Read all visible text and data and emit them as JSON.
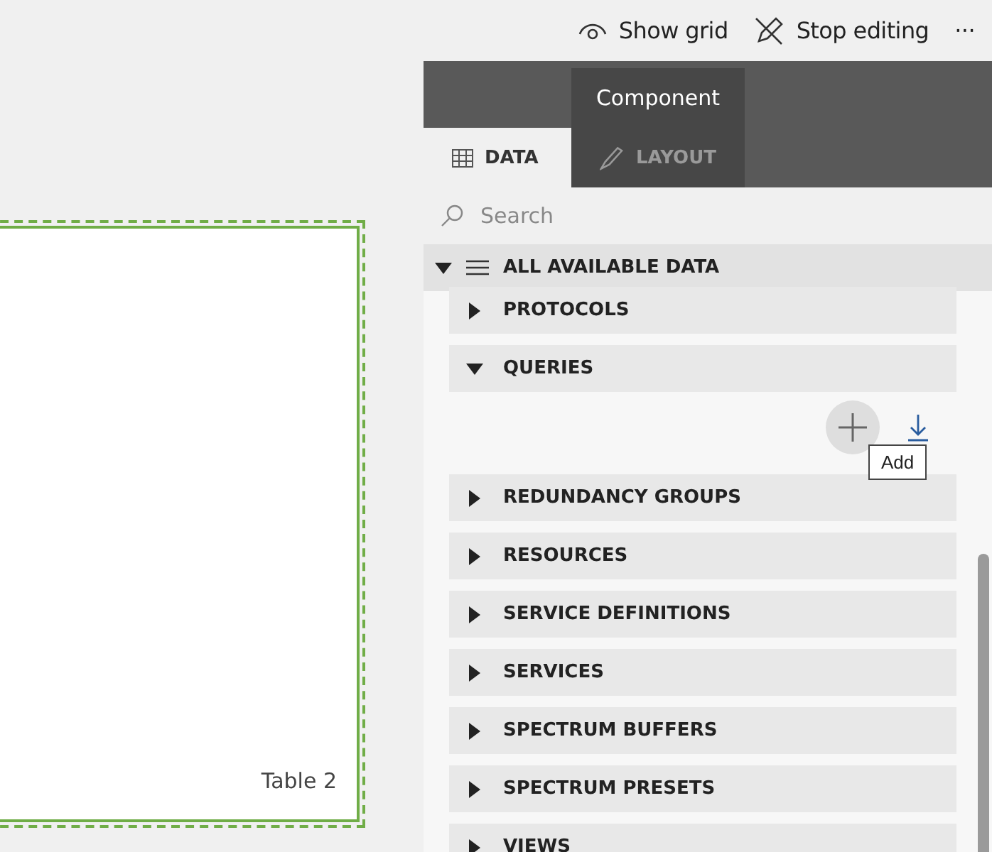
{
  "toolbar": {
    "actions": [
      {
        "kind": "eye",
        "label": "Show grid"
      },
      {
        "kind": "pencil",
        "label": "Stop editing"
      },
      {
        "kind": "more",
        "label": "···"
      }
    ]
  },
  "canvas": {
    "component": {
      "label": "Table 2",
      "selected": true
    }
  },
  "panel": {
    "tabs": [
      {
        "kind": "table",
        "label": "DATA",
        "selected": true
      },
      {
        "kind": "brush",
        "label": "LAYOUT",
        "selected": false
      }
    ],
    "tab_tooltip": "Component",
    "search": {
      "placeholder": "Search"
    },
    "tree": {
      "label": "ALL AVAILABLE DATA",
      "expanded": true,
      "sections": [
        {
          "label": "PROTOCOLS",
          "expanded": false
        },
        {
          "label": "QUERIES",
          "expanded": true,
          "actions": [
            {
              "kind": "add",
              "hovered": true,
              "tooltip": "Add"
            },
            {
              "kind": "download",
              "hovered": false
            }
          ]
        },
        {
          "label": "REDUNDANCY GROUPS",
          "expanded": false
        },
        {
          "label": "RESOURCES",
          "expanded": false
        },
        {
          "label": "SERVICE DEFINITIONS",
          "expanded": false
        },
        {
          "label": "SERVICES",
          "expanded": false
        },
        {
          "label": "SPECTRUM BUFFERS",
          "expanded": false
        },
        {
          "label": "SPECTRUM PRESETS",
          "expanded": false
        },
        {
          "label": "VIEWS",
          "expanded": false
        }
      ]
    }
  }
}
